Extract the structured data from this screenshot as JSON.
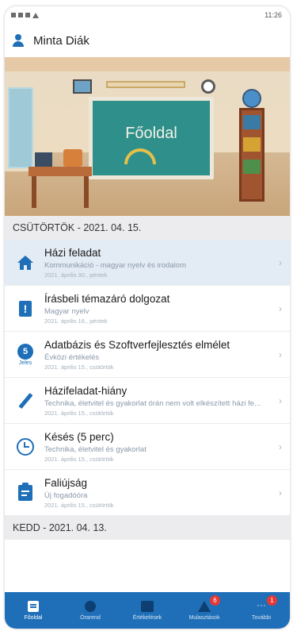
{
  "status_bar": {
    "time": "11:26"
  },
  "user": {
    "name": "Minta Diák"
  },
  "hero": {
    "title": "Főoldal"
  },
  "sections": [
    {
      "date": "CSÜTÖRTÖK - 2021. 04. 15.",
      "items": [
        {
          "icon": "house-icon",
          "title": "Házi feladat",
          "subtitle": "Kommunikáció - magyar nyelv és irodalom",
          "date": "2021. április 30., péntek"
        },
        {
          "icon": "exclamation-icon",
          "title": "Írásbeli témazáró dolgozat",
          "subtitle": "Magyar nyelv",
          "date": "2021. április 16., péntek"
        },
        {
          "icon": "grade-icon",
          "grade": "5",
          "grade_label": "Jeles",
          "title": "Adatbázis és Szoftverfejlesztés elmélet",
          "subtitle": "Évközi értékelés",
          "date": "2021. április 15., csütörtök"
        },
        {
          "icon": "pencil-icon",
          "title": "Házifeladat-hiány",
          "subtitle": "Technika, életvitel és gyakorlat órán nem volt elkészített házi fe...",
          "date": "2021. április 15., csütörtök"
        },
        {
          "icon": "clock-icon",
          "title": "Késés (5 perc)",
          "subtitle": "Technika, életvitel és gyakorlat",
          "date": "2021. április 15., csütörtök"
        },
        {
          "icon": "board-icon",
          "title": "Faliújság",
          "subtitle": "Új fogadóóra",
          "date": "2021. április 15., csütörtök"
        }
      ]
    },
    {
      "date": "KEDD - 2021. 04. 13."
    }
  ],
  "tabbar": {
    "tabs": [
      {
        "label": "Főoldal",
        "active": true
      },
      {
        "label": "Órarend"
      },
      {
        "label": "Értékelések"
      },
      {
        "label": "Mulasztások",
        "badge": "6"
      },
      {
        "label": "További",
        "badge": "1"
      }
    ]
  },
  "colors": {
    "primary": "#1e6fb8",
    "highlight": "#e3ebf4",
    "badge": "#e53935"
  }
}
